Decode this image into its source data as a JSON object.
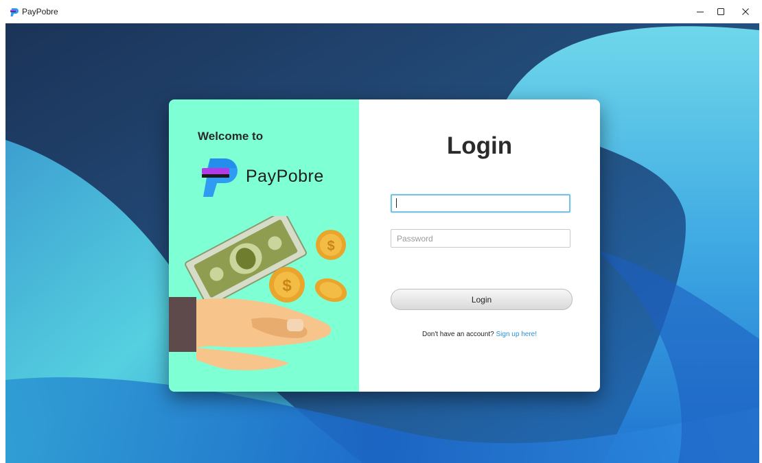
{
  "window": {
    "title": "PayPobre",
    "controls": [
      "minimize-icon",
      "maximize-icon",
      "close-icon"
    ]
  },
  "left_panel": {
    "welcome_text": "Welcome to",
    "brand_name": "PayPobre",
    "background_color": "#7fffd4",
    "illustration": "hand-with-money-illustration"
  },
  "login_form": {
    "title": "Login",
    "username_value": "",
    "password_placeholder": "Password",
    "button_label": "Login",
    "signup_prompt": "Don't have an account?",
    "signup_link": "Sign up here!"
  },
  "colors": {
    "accent_link": "#2b8fd6",
    "focus_border": "#7ac1dd",
    "desktop_dark": "#1d3a63",
    "desktop_light": "#4fc6dc"
  }
}
